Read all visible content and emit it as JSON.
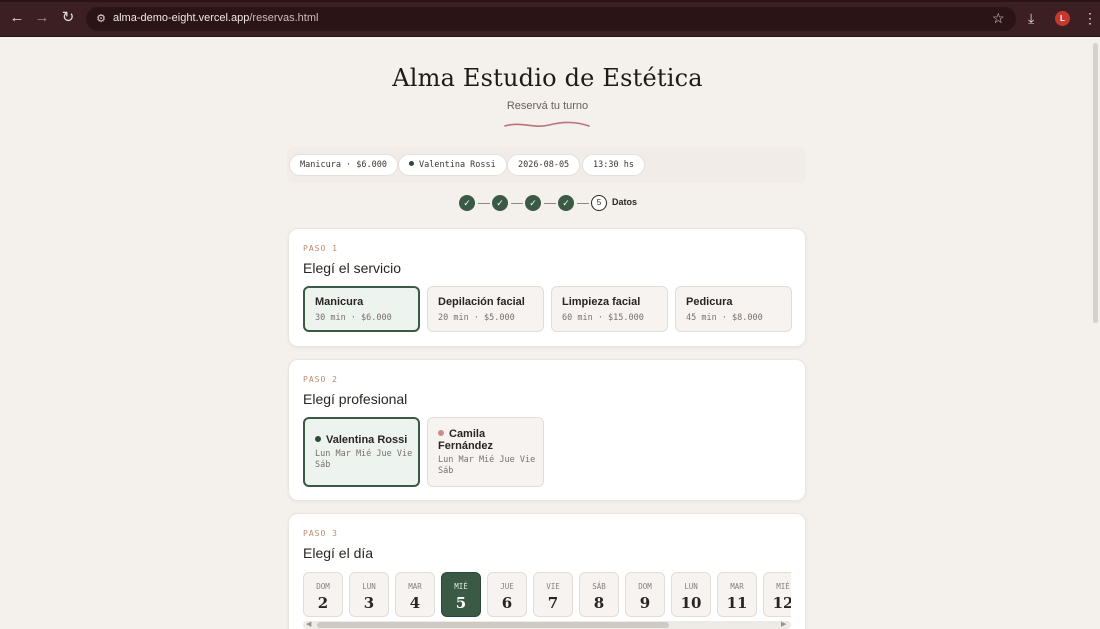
{
  "browser": {
    "url_host": "alma-demo-eight.vercel.app",
    "url_path": "/reservas.html",
    "avatar_letter": "L"
  },
  "header": {
    "title": "Alma Estudio de Estética",
    "subtitle": "Reservá tu turno"
  },
  "summary": {
    "service": "Manicura · $6.000",
    "professional": "Valentina Rossi",
    "date": "2026-08-05",
    "time": "13:30 hs"
  },
  "stepper": {
    "steps": [
      "✓",
      "✓",
      "✓",
      "✓",
      "5"
    ],
    "current_label": "Datos",
    "current_step": 5
  },
  "step1": {
    "kicker": "PASO 1",
    "title": "Elegí el servicio",
    "options": [
      {
        "name": "Manicura",
        "meta": "30 min · $6.000",
        "selected": true
      },
      {
        "name": "Depilación facial",
        "meta": "20 min · $5.000",
        "selected": false
      },
      {
        "name": "Limpieza facial",
        "meta": "60 min · $15.000",
        "selected": false
      },
      {
        "name": "Pedicura",
        "meta": "45 min · $8.000",
        "selected": false
      }
    ]
  },
  "step2": {
    "kicker": "PASO 2",
    "title": "Elegí profesional",
    "options": [
      {
        "name": "Valentina Rossi",
        "days": "Lun Mar Mié Jue Vie Sáb",
        "dot_color": "#2f4a3a",
        "selected": true
      },
      {
        "name": "Camila Fernández",
        "days": "Lun Mar Mié Jue Vie Sáb",
        "dot_color": "#d08a8a",
        "selected": false
      }
    ]
  },
  "step3": {
    "kicker": "PASO 3",
    "title": "Elegí el día",
    "days": [
      {
        "weekday": "DOM",
        "num": "2"
      },
      {
        "weekday": "LUN",
        "num": "3"
      },
      {
        "weekday": "MAR",
        "num": "4"
      },
      {
        "weekday": "MIÉ",
        "num": "5",
        "selected": true
      },
      {
        "weekday": "JUE",
        "num": "6"
      },
      {
        "weekday": "VIE",
        "num": "7"
      },
      {
        "weekday": "SÁB",
        "num": "8"
      },
      {
        "weekday": "DOM",
        "num": "9"
      },
      {
        "weekday": "LUN",
        "num": "10"
      },
      {
        "weekday": "MAR",
        "num": "11"
      },
      {
        "weekday": "MIÉ",
        "num": "12"
      }
    ]
  },
  "colors": {
    "accent_green": "#3a5a45",
    "page_bg": "#f4f0ec",
    "chrome_bg": "#3b1f22",
    "kicker": "#c08a6e",
    "flourish": "#b87479"
  }
}
